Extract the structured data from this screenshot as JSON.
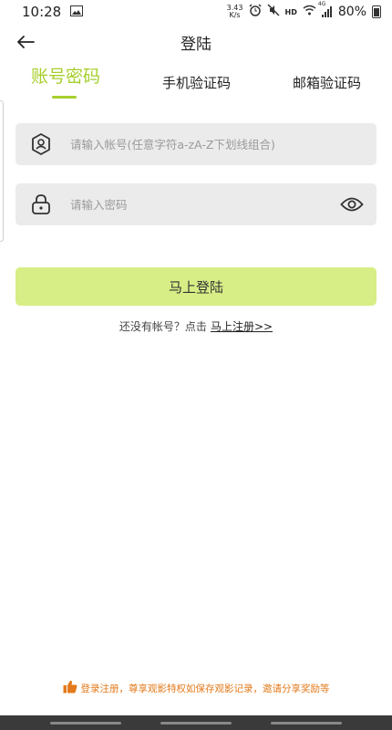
{
  "status_bar": {
    "time": "10:28",
    "net_speed_value": "3.43",
    "net_speed_unit": "K/s",
    "hd": "HD",
    "signal_label": "4G",
    "battery": "80%"
  },
  "header": {
    "title": "登陆"
  },
  "tabs": [
    {
      "label": "账号密码",
      "active": true
    },
    {
      "label": "手机验证码",
      "active": false
    },
    {
      "label": "邮箱验证码",
      "active": false
    }
  ],
  "form": {
    "account_placeholder": "请输入帐号(任意字符a-zA-Z下划线组合)",
    "account_value": "",
    "password_placeholder": "请输入密码",
    "password_value": ""
  },
  "login_button": "马上登陆",
  "register": {
    "prompt": "还没有帐号？点击",
    "link": "马上注册>>"
  },
  "bottom_tip": "登录注册，尊享观影特权如保存观影记录，邀请分享奖励等",
  "colors": {
    "accent": "#a6cf2b",
    "button_bg": "#d7ee86",
    "tip": "#e37a1b"
  }
}
